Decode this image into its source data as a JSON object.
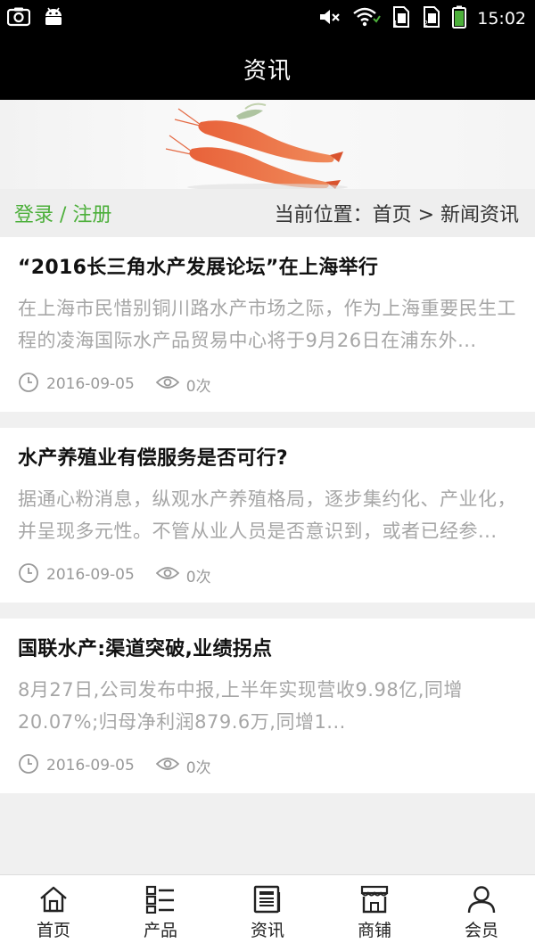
{
  "status_bar": {
    "time": "15:02",
    "icons": [
      "screenshot-icon",
      "android-icon",
      "mute-icon",
      "wifi-icon",
      "sim1-icon",
      "sim2-icon",
      "battery-icon"
    ]
  },
  "header": {
    "title": "资讯"
  },
  "banner": {
    "image": "shrimp-banner"
  },
  "breadcrumb": {
    "login_label": "登录 / 注册",
    "location": "当前位置：首页 > 新闻资讯"
  },
  "news": [
    {
      "title": "“2016长三角水产发展论坛”在上海举行",
      "summary": "在上海市民惜别铜川路水产市场之际，作为上海重要民生工程的凌海国际水产品贸易中心将于9月26日在浦东外...",
      "date": "2016-09-05",
      "views": "0次"
    },
    {
      "title": "水产养殖业有偿服务是否可行?",
      "summary": "据通心粉消息，纵观水产养殖格局，逐步集约化、产业化，并呈现多元性。不管从业人员是否意识到，或者已经参...",
      "date": "2016-09-05",
      "views": "0次"
    },
    {
      "title": "国联水产:渠道突破,业绩拐点",
      "summary": "8月27日,公司发布中报,上半年实现营收9.98亿,同增20.07%;归母净利润879.6万,同增1...",
      "date": "2016-09-05",
      "views": "0次"
    }
  ],
  "tabs": [
    {
      "label": "首页",
      "icon": "home-icon"
    },
    {
      "label": "产品",
      "icon": "product-list-icon"
    },
    {
      "label": "资讯",
      "icon": "news-icon"
    },
    {
      "label": "商铺",
      "icon": "shop-icon"
    },
    {
      "label": "会员",
      "icon": "member-icon"
    }
  ],
  "colors": {
    "accent": "#4caf3a",
    "header_bg": "#000000",
    "summary_text": "#a6a6a6"
  }
}
